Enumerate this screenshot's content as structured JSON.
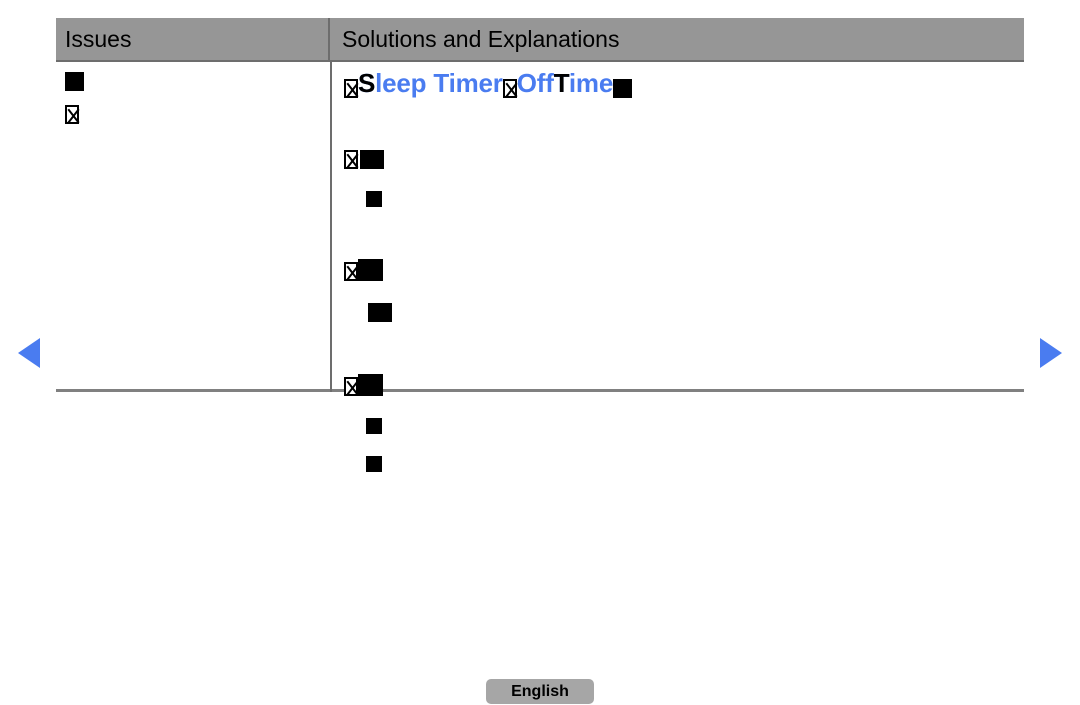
{
  "table": {
    "headers": {
      "issues": "Issues",
      "solutions": "Solutions and Explanations"
    },
    "issues_rows": [
      {
        "glyphs": [
          "filled-box"
        ]
      },
      {
        "glyphs": [
          "tofu-box"
        ]
      }
    ],
    "solution_rows": [
      {
        "id": "row-1",
        "indent": "lead",
        "leading_glyph": "tofu-box",
        "text_blue": "Sleep Timer",
        "text_overlay_black": "S",
        "segments": [
          {
            "glyph": "tofu-box"
          },
          {
            "blue": "Off",
            "overlay_black": ""
          },
          {
            "blue": "Time",
            "overlay_black": "T"
          },
          {
            "glyph": "filled-box"
          }
        ]
      },
      {
        "id": "row-2",
        "indent": "lead",
        "glyphs": [
          "tofu-box",
          "partial-box",
          "filled-box"
        ]
      },
      {
        "id": "row-2-sub",
        "indent": "sub",
        "glyphs": [
          "filled-box"
        ]
      },
      {
        "id": "row-3",
        "indent": "lead",
        "glyphs": [
          "tofu-box",
          "filled-box"
        ]
      },
      {
        "id": "row-3-sub",
        "indent": "sub",
        "glyphs": [
          "partial-box",
          "filled-box"
        ]
      },
      {
        "id": "row-4",
        "indent": "lead",
        "glyphs": [
          "tofu-box",
          "filled-box"
        ]
      },
      {
        "id": "row-4-sub1",
        "indent": "sub",
        "glyphs": [
          "filled-box"
        ]
      },
      {
        "id": "row-4-sub2",
        "indent": "sub2",
        "glyphs": [
          "filled-box"
        ]
      }
    ]
  },
  "navigation": {
    "prev_label": "previous-page",
    "next_label": "next-page"
  },
  "footer": {
    "language_button": "English"
  },
  "colors": {
    "header_bg": "#969696",
    "header_border": "#6d6d6d",
    "accent_blue": "#4a7cf0",
    "button_bg": "#a6a6a6",
    "table_bottom_border": "#808080"
  }
}
